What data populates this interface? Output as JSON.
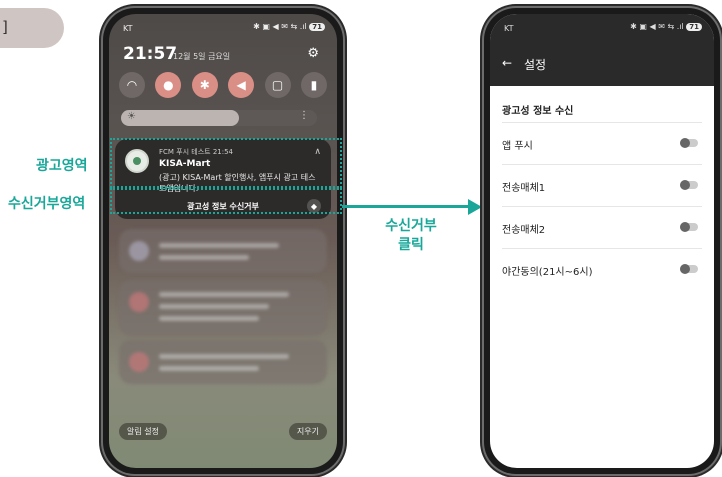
{
  "tab": {
    "label": "]"
  },
  "labels": {
    "ad_area": "광고영역",
    "reject_area": "수신거부영역",
    "arrow_line1": "수신거부",
    "arrow_line2": "클릭"
  },
  "phone1": {
    "carrier": "KT",
    "status_icons": "✱ ▣ ◀ ✉ ⇆ .ıl",
    "battery": "71",
    "time": "21:57",
    "date": "12월 5일 금요일",
    "brightness_level": 0.6,
    "notification": {
      "app_line": "FCM 푸시 테스트  21:54",
      "title": "KISA-Mart",
      "body": "(광고) KISA-Mart 할인행사, 앱푸시 광고 테스트앱입니다.",
      "action": "광고성 정보 수신거부"
    },
    "bottom_left": "알림 설정",
    "bottom_right": "지우기"
  },
  "phone2": {
    "carrier": "KT",
    "status_icons": "✱ ▣ ◀ ✉ ⇆ .ıl",
    "battery": "71",
    "title": "설정",
    "section": "광고성 정보 수신",
    "items": [
      {
        "label": "앱 푸시",
        "on": false
      },
      {
        "label": "전송매체1",
        "on": false
      },
      {
        "label": "전송매체2",
        "on": false
      },
      {
        "label": "야간동의(21시~6시)",
        "on": false
      }
    ]
  },
  "colors": {
    "accent": "#1aa79a"
  }
}
